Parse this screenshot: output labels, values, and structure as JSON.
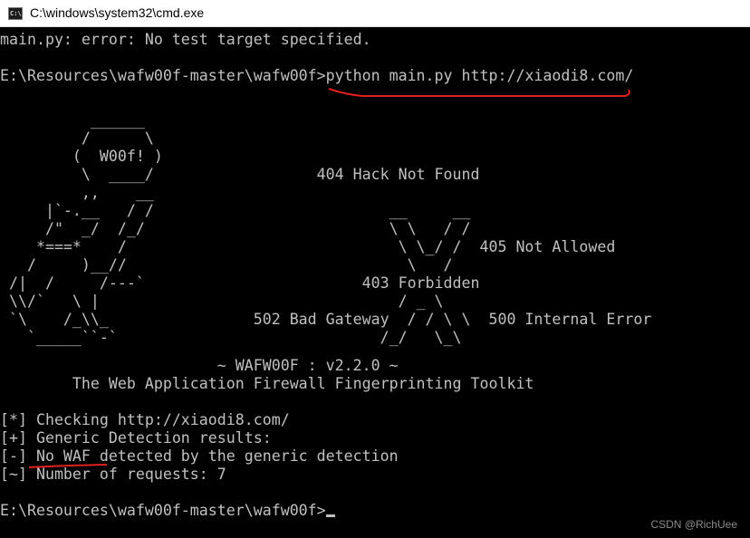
{
  "window": {
    "title": "C:\\windows\\system32\\cmd.exe",
    "icon": "cmd-icon"
  },
  "console": {
    "line_error": "main.py: error: No test target specified.",
    "prompt_1": "E:\\Resources\\wafw00f-master\\wafw00f>",
    "command_1": "python main.py http://xiaodi8.com/",
    "banner_art": "          ______\n         /      \\\n        (  W00f! )\n         \\  ____/                  404 Hack Not Found\n         ,,    __\n     |`-.__   / /                          __     __\n     /\"  _/  /_/                           \\ \\   / /\n    *===*    /                              \\ \\_/ /  405 Not Allowed\n   /     )__//                               \\   /\n /|  /     /---`                        403 Forbidden\n \\\\/`   \\ |                                 / _ \\\n `\\    /_\\\\_                502 Bad Gateway  / / \\ \\  500 Internal Error\n   `_____``-`                             /_/   \\_\\",
    "version_line": "                        ~ WAFW00F : v2.2.0 ~",
    "tagline": "        The Web Application Firewall Fingerprinting Toolkit",
    "result_checking": "[*] Checking http://xiaodi8.com/",
    "result_generic": "[+] Generic Detection results:",
    "result_nowaf": "[-] No WAF detected by the generic detection",
    "result_requests": "[~] Number of requests: 7",
    "prompt_2": "E:\\Resources\\wafw00f-master\\wafw00f>"
  },
  "annotation_color": "#e02020",
  "watermark": "CSDN @RichUee"
}
